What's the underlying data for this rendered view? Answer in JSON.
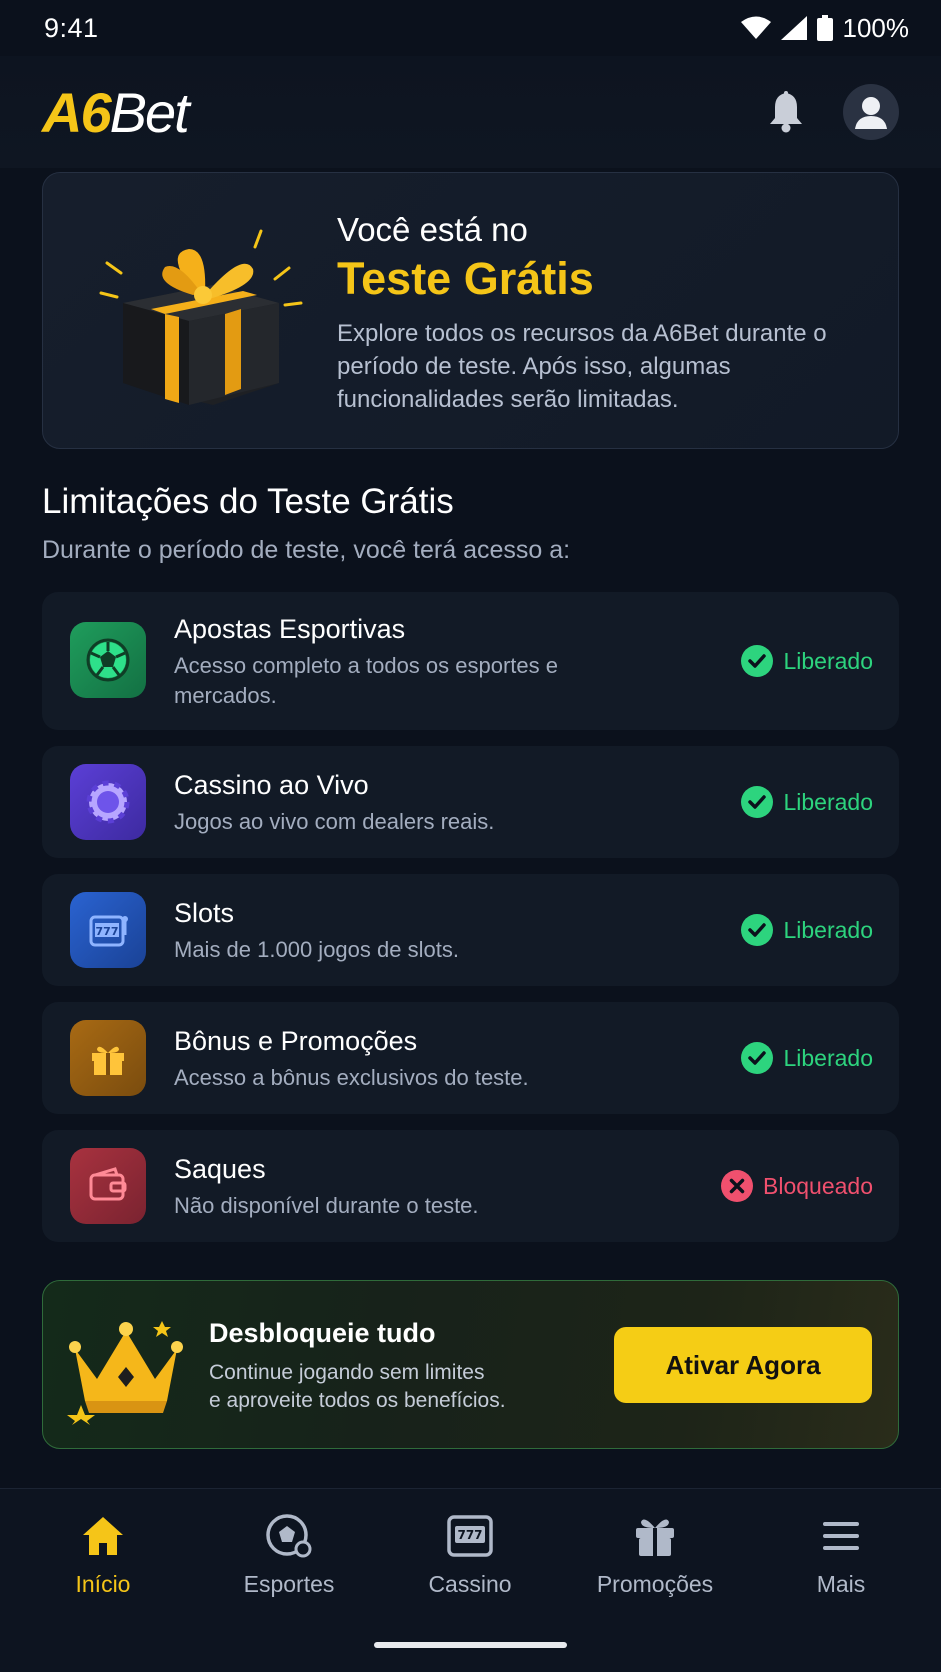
{
  "status_bar": {
    "time": "9:41",
    "battery": "100%",
    "icons": [
      "wifi-icon",
      "signal-icon",
      "battery-icon"
    ]
  },
  "header": {
    "logo_a6": "A6",
    "logo_bet": "Bet",
    "icons": [
      "bell-icon",
      "user-avatar-icon"
    ]
  },
  "hero": {
    "pre_title": "Você está no",
    "title": "Teste Grátis",
    "description": "Explore todos os recursos da A6Bet durante o período de teste. Após isso, algumas funcionalidades serão limitadas.",
    "icon": "gift-box-icon"
  },
  "limits": {
    "title": "Limitações do Teste Grátis",
    "subtitle": "Durante o período de teste, você terá acesso a:",
    "items": [
      {
        "title": "Apostas Esportivas",
        "description": "Acesso completo a todos os esportes e mercados.",
        "status": "Liberado",
        "icon": "soccer-ball-icon",
        "icon_color": "#1f9d5c"
      },
      {
        "title": "Cassino ao Vivo",
        "description": "Jogos ao vivo com dealers reais.",
        "status": "Liberado",
        "icon": "casino-chip-icon",
        "icon_color": "#5b3fd6"
      },
      {
        "title": "Slots",
        "description": "Mais de 1.000 jogos de slots.",
        "status": "Liberado",
        "icon": "slot-machine-icon",
        "icon_color": "#2a63d1"
      },
      {
        "title": "Bônus e Promoções",
        "description": "Acesso a bônus exclusivos do teste.",
        "status": "Liberado",
        "icon": "gift-icon",
        "icon_color": "#a86a14"
      },
      {
        "title": "Saques",
        "description": "Não disponível durante o teste.",
        "status": "Bloqueado",
        "icon": "wallet-icon",
        "icon_color": "#a8323f"
      }
    ]
  },
  "cta": {
    "title": "Desbloqueie tudo",
    "description_line1": "Continue jogando sem limites",
    "description_line2": "e aproveite todos os benefícios.",
    "button": "Ativar Agora",
    "icon": "crown-icon"
  },
  "nav": {
    "items": [
      {
        "label": "Início",
        "icon": "home-icon",
        "active": true
      },
      {
        "label": "Esportes",
        "icon": "soccer-ball-icon",
        "active": false
      },
      {
        "label": "Cassino",
        "icon": "slot-machine-icon",
        "active": false
      },
      {
        "label": "Promoções",
        "icon": "gift-icon",
        "active": false
      },
      {
        "label": "Mais",
        "icon": "menu-icon",
        "active": false
      }
    ]
  },
  "colors": {
    "accent": "#f5c518",
    "success": "#2dd47e",
    "danger": "#f0506e",
    "background": "#0b111c"
  }
}
